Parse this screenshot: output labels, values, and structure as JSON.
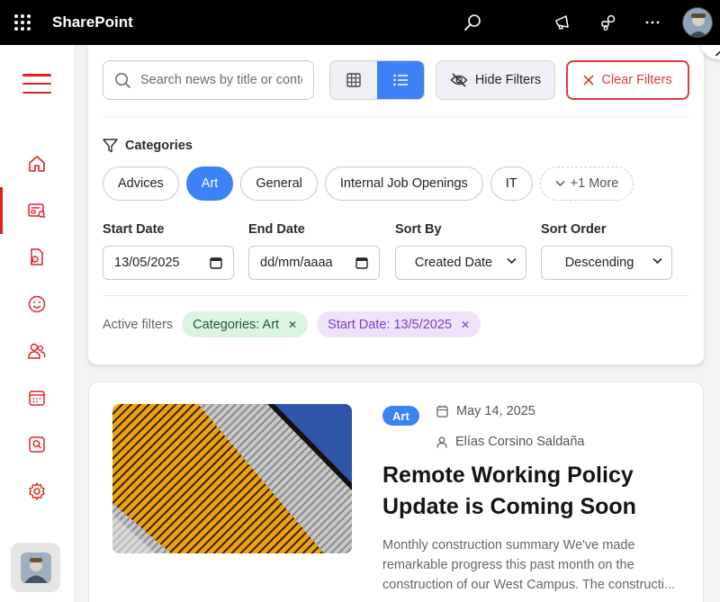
{
  "app": {
    "title": "SharePoint"
  },
  "topbar": {
    "icons": [
      "waffle-icon",
      "search-icon",
      "megaphone-icon",
      "share-icon",
      "more-icon",
      "avatar"
    ]
  },
  "sidebar": {
    "items": [
      {
        "name": "home-icon"
      },
      {
        "name": "news-icon",
        "active": true
      },
      {
        "name": "document-search-icon"
      },
      {
        "name": "smiley-icon"
      },
      {
        "name": "people-icon"
      },
      {
        "name": "calendar-icon"
      },
      {
        "name": "search-box-icon"
      },
      {
        "name": "gear-icon"
      }
    ]
  },
  "filters": {
    "search_placeholder": "Search news by title or content...",
    "hide_label": "Hide Filters",
    "clear_label": "Clear Filters",
    "categories_title": "Categories",
    "categories": [
      "Advices",
      "Art",
      "General",
      "Internal Job Openings",
      "IT"
    ],
    "selected_category": "Art",
    "more_label": "+1 More",
    "start_date_label": "Start Date",
    "start_date_value": "13/05/2025",
    "end_date_label": "End Date",
    "end_date_value": "dd/mm/aaaa",
    "sort_by_label": "Sort By",
    "sort_by_value": "Created Date",
    "sort_order_label": "Sort Order",
    "sort_order_value": "Descending",
    "active_label": "Active filters",
    "active_chips": [
      {
        "label": "Categories: Art",
        "color": "green"
      },
      {
        "label": "Start Date: 13/5/2025",
        "color": "purple"
      }
    ]
  },
  "article": {
    "category": "Art",
    "date": "May 14, 2025",
    "author": "Elías Corsino Saldaña",
    "title": "Remote Working Policy Update is Coming Soon",
    "excerpt": "Monthly construction summary We've made remarkable progress this past month on the construction of our West Campus. The constructi..."
  },
  "colors": {
    "accent": "#3b82f6",
    "brand_red": "#e02020",
    "topbar": "#000000"
  }
}
